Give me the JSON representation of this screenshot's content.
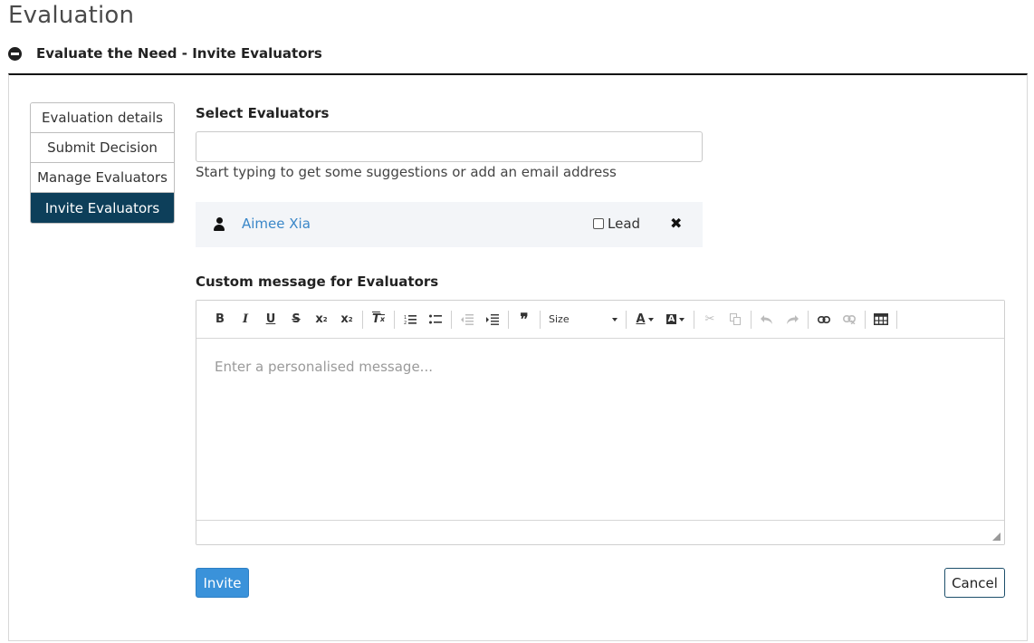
{
  "page": {
    "title": "Evaluation"
  },
  "section": {
    "title": "Evaluate the Need - Invite Evaluators"
  },
  "sidenav": {
    "items": [
      {
        "label": "Evaluation details",
        "active": false
      },
      {
        "label": "Submit Decision",
        "active": false
      },
      {
        "label": "Manage Evaluators",
        "active": false
      },
      {
        "label": "Invite Evaluators",
        "active": true
      }
    ]
  },
  "select_evaluators": {
    "label": "Select Evaluators",
    "value": "",
    "help": "Start typing to get some suggestions or add an email address"
  },
  "evaluators": [
    {
      "name": "Aimee Xia",
      "lead_label": "Lead",
      "lead_checked": false
    }
  ],
  "message": {
    "label": "Custom message for Evaluators",
    "placeholder": "Enter a personalised message...",
    "toolbar": {
      "size_label": "Size",
      "buttons": [
        "bold-icon",
        "italic-icon",
        "underline-icon",
        "strikethrough-icon",
        "subscript-icon",
        "superscript-icon",
        "remove-format-icon",
        "numbered-list-icon",
        "bulleted-list-icon",
        "outdent-icon",
        "indent-icon",
        "blockquote-icon",
        "text-color-icon",
        "background-color-icon",
        "cut-icon",
        "copy-icon",
        "undo-icon",
        "redo-icon",
        "link-icon",
        "unlink-icon",
        "table-icon"
      ]
    }
  },
  "actions": {
    "invite_label": "Invite",
    "cancel_label": "Cancel"
  },
  "colors": {
    "accent": "#3a92da",
    "nav_active": "#0d3f5a",
    "link": "#3a87c8"
  }
}
